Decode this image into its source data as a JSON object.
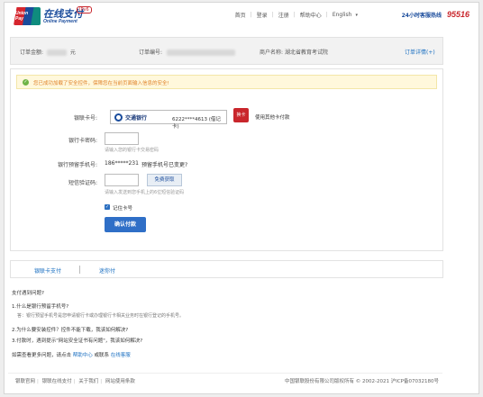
{
  "header": {
    "logo_text": "UnionPay 银联",
    "brand_cn": "在线支付",
    "brand_en": "Online Payment",
    "ipv6": "IPv6",
    "nav": [
      "首页",
      "登录",
      "注册",
      "帮助中心",
      "English"
    ],
    "hotline_label": "24小时客服热线",
    "hotline_number": "95516"
  },
  "order": {
    "amount_label": "订单金额:",
    "amount_unit": "元",
    "number_label": "订单编号:",
    "merchant_label": "商户名称:",
    "merchant_name": "湖北省教育考试院",
    "detail_label": "订单详情(+)"
  },
  "notice": "您已成功加载了安全控件，保障您在当前页面输入信息的安全!",
  "form": {
    "card_label": "银联卡号:",
    "bank_name": "交通银行",
    "card_number": "6222****4613 (借记卡)",
    "hw_button": "换卡",
    "other_card_link": "使用其他卡付款",
    "password_label": "银行卡密码:",
    "password_hint": "请输入您的银行卡交易密码",
    "phone_label": "银行预留手机号:",
    "phone_value": "186*****231",
    "phone_changed_link": "预留手机号已变更?",
    "sms_label": "短信验证码:",
    "sms_button": "免费获取",
    "sms_hint": "请输入发送到您手机上的6位短信验证码",
    "remember_label": "记住卡号",
    "pay_button": "确认付款"
  },
  "tabs": [
    "银联卡支付",
    "迷你付"
  ],
  "faq": {
    "title": "支付遇到问题?",
    "q1": "1.什么是银行预留手机号?",
    "a1": "答：银行预留手机号是您申请银行卡或办理银行卡相关业务时在银行登记的手机号。",
    "q2": "2.为什么要安装控件？控件不能下载，我该如何解决?",
    "q3": "3.付款时，遇到提示\"网站安全证书有问题\"，我该如何解决?",
    "more_prefix": "如需查看更多问题，请点击",
    "help_link": "帮助中心",
    "or_text": "或联系",
    "service_link": "在线客服"
  },
  "footer": {
    "links": [
      "银联官网",
      "银联在线支付",
      "关于我们",
      "网站使用条款"
    ],
    "copyright": "中国银联股份有限公司版权所有 © 2002-2021  沪ICP备07032180号"
  }
}
